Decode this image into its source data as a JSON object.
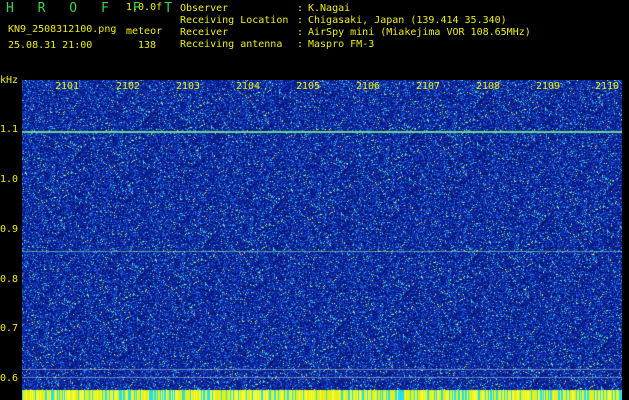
{
  "app": {
    "name": "H R O F F T",
    "version": "1.0.0f",
    "filename": "KN9_2508312100.png",
    "mode": "meteor",
    "timestamp": "25.08.31 21:00",
    "count": "138"
  },
  "info": [
    {
      "label": "Observer",
      "value": "K.Nagai"
    },
    {
      "label": "Receiving Location",
      "value": "Chigasaki, Japan (139.414 35.340)"
    },
    {
      "label": "Receiver",
      "value": "AirSpy mini (Miakejima VOR 108.65MHz)"
    },
    {
      "label": "Receiving antenna",
      "value": "Maspro FM-3"
    }
  ],
  "plot": {
    "unit_label": "kHz",
    "time_labels": [
      "2101",
      "2102",
      "2103",
      "2104",
      "2105",
      "2106",
      "2107",
      "2108",
      "2109",
      "2110"
    ],
    "freq_labels": [
      "1.1",
      "1.0",
      "0.9",
      "0.8",
      "0.7",
      "0.6"
    ]
  },
  "colors": {
    "background": "#000000",
    "text": "#f0f000",
    "brand": "#2fd84a",
    "spectrogram_base": "#0a1f94"
  }
}
